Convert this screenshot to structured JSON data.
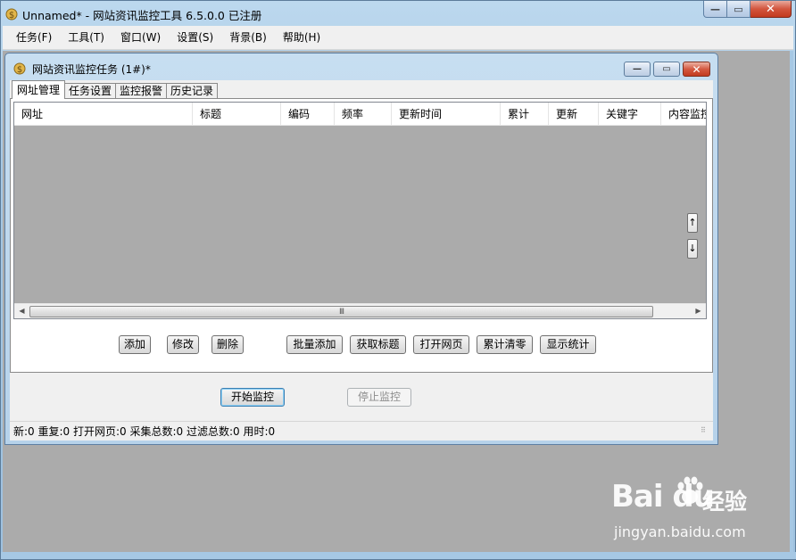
{
  "window": {
    "title": "Unnamed* - 网站资讯监控工具 6.5.0.0  已注册"
  },
  "menu": [
    "任务(F)",
    "工具(T)",
    "窗口(W)",
    "设置(S)",
    "背景(B)",
    "帮助(H)"
  ],
  "child": {
    "title": "网站资讯监控任务  (1#)*",
    "tabs": [
      "网址管理",
      "任务设置",
      "监控报警",
      "历史记录"
    ],
    "columns": [
      "网址",
      "标题",
      "编码",
      "频率",
      "更新时间",
      "累计",
      "更新",
      "关键字",
      "内容监控"
    ],
    "updown": {
      "up": "↑",
      "down": "↓"
    },
    "scroll_grip": "III",
    "actions": [
      "添加",
      "修改",
      "删除",
      "批量添加",
      "获取标题",
      "打开网页",
      "累计清零",
      "显示统计"
    ],
    "start_button": "开始监控",
    "stop_button": "停止监控",
    "status": "新:0  重复:0  打开网页:0  采集总数:0  过滤总数:0  用时:0"
  },
  "watermark": {
    "logo": "Bai  du",
    "cn": "经验",
    "url": "jingyan.baidu.com"
  },
  "icons": [
    "app-icon",
    "minimize-icon",
    "maximize-icon",
    "close-icon",
    "child-app-icon",
    "scroll-left-icon",
    "scroll-right-icon",
    "resize-grip-icon"
  ],
  "colors": {
    "title_bar": "#a6c8e4",
    "mdi_bg": "#ababab",
    "close_red": "#c33a1f",
    "list_bg": "#ababab"
  }
}
